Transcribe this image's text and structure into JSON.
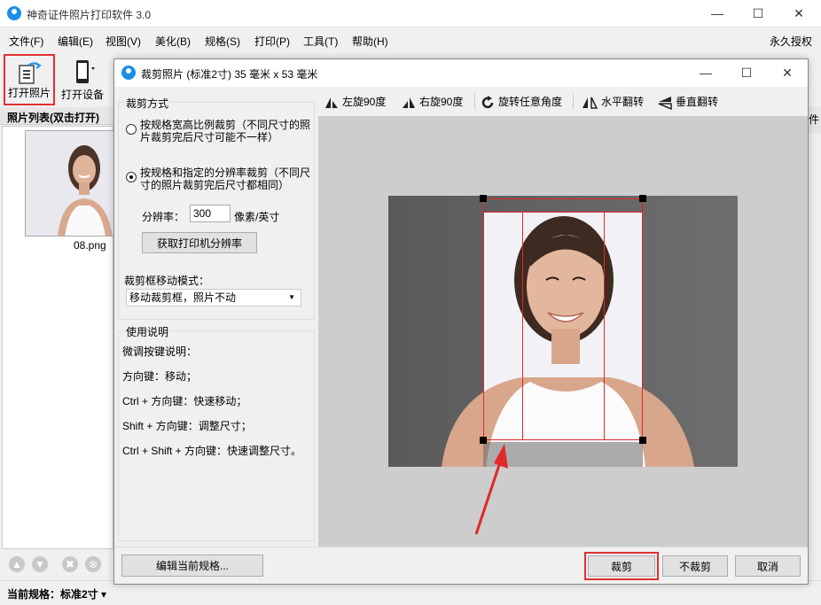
{
  "app": {
    "title": "神奇证件照片打印软件 3.0",
    "accent": "#1a8ee8",
    "highlight": "#e03030"
  },
  "window_controls": {
    "minimize": "—",
    "maximize": "☐",
    "close": "✕"
  },
  "menu": {
    "items": [
      "文件(F)",
      "编辑(E)",
      "视图(V)",
      "美化(B)",
      "规格(S)",
      "打印(P)",
      "工具(T)",
      "帮助(H)"
    ],
    "license": "永久授权"
  },
  "toolbar": {
    "open_photo": "打开照片",
    "open_device": "打开设备"
  },
  "photo_list": {
    "header": "照片列表(双击打开)",
    "items": [
      {
        "name": "08.png"
      }
    ]
  },
  "status": {
    "current_spec": "当前规格：标准2寸 ▾"
  },
  "right_edge_label": "件",
  "dialog": {
    "title": "裁剪照片 (标准2寸) 35 毫米 x 53 毫米",
    "crop_mode": {
      "title": "裁剪方式",
      "option1": "按规格宽高比例裁剪（不同尺寸的照片裁剪完后尺寸可能不一样）",
      "option2": "按规格和指定的分辨率裁剪（不同尺寸的照片裁剪完后尺寸都相同）",
      "resolution_label": "分辨率：",
      "resolution_value": "300",
      "resolution_unit": "像素/英寸",
      "get_printer_resolution": "获取打印机分辨率"
    },
    "move_mode": {
      "label": "裁剪框移动模式：",
      "selected": "移动裁剪框，照片不动"
    },
    "help": {
      "title": "使用说明",
      "lines": [
        "微调按键说明：",
        "方向键：移动；",
        "Ctrl + 方向键：快速移动；",
        "Shift + 方向键：调整尺寸；",
        "Ctrl + Shift + 方向键：快速调整尺寸。"
      ]
    },
    "image_tools": {
      "rotate_left": "左旋90度",
      "rotate_right": "右旋90度",
      "rotate_any": "旋转任意角度",
      "flip_h": "水平翻转",
      "flip_v": "垂直翻转"
    },
    "footer": {
      "edit_spec": "编辑当前规格...",
      "crop": "裁剪",
      "no_crop": "不裁剪",
      "cancel": "取消"
    }
  }
}
